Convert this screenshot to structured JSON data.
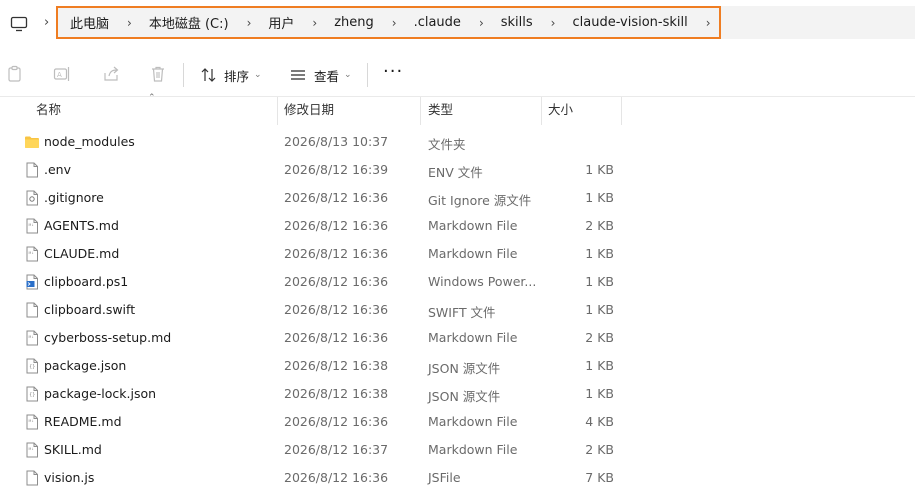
{
  "address_bar": {
    "root_icon": "this-pc-icon",
    "crumbs": [
      "此电脑",
      "本地磁盘 (C:)",
      "用户",
      "zheng",
      ".claude",
      "skills",
      "claude-vision-skill"
    ],
    "highlight_color": "#ef7d22"
  },
  "toolbar": {
    "icons": [
      "paste-icon",
      "rename-icon",
      "share-icon",
      "delete-icon"
    ],
    "sort_label": "排序",
    "view_label": "查看",
    "more_label": "···"
  },
  "columns": {
    "name": "名称",
    "date": "修改日期",
    "type": "类型",
    "size": "大小"
  },
  "files": [
    {
      "name": "node_modules",
      "date": "2026/8/13 10:37",
      "type": "文件夹",
      "size": "",
      "icon": "folder-icon"
    },
    {
      "name": ".env",
      "date": "2026/8/12 16:39",
      "type": "ENV 文件",
      "size": "1 KB",
      "icon": "file-icon"
    },
    {
      "name": ".gitignore",
      "date": "2026/8/12 16:36",
      "type": "Git Ignore 源文件",
      "size": "1 KB",
      "icon": "settings-file-icon"
    },
    {
      "name": "AGENTS.md",
      "date": "2026/8/12 16:36",
      "type": "Markdown File",
      "size": "2 KB",
      "icon": "markdown-file-icon"
    },
    {
      "name": "CLAUDE.md",
      "date": "2026/8/12 16:36",
      "type": "Markdown File",
      "size": "1 KB",
      "icon": "markdown-file-icon"
    },
    {
      "name": "clipboard.ps1",
      "date": "2026/8/12 16:36",
      "type": "Windows Power...",
      "size": "1 KB",
      "icon": "powershell-file-icon"
    },
    {
      "name": "clipboard.swift",
      "date": "2026/8/12 16:36",
      "type": "SWIFT 文件",
      "size": "1 KB",
      "icon": "file-icon"
    },
    {
      "name": "cyberboss-setup.md",
      "date": "2026/8/12 16:36",
      "type": "Markdown File",
      "size": "2 KB",
      "icon": "markdown-file-icon"
    },
    {
      "name": "package.json",
      "date": "2026/8/12 16:38",
      "type": "JSON 源文件",
      "size": "1 KB",
      "icon": "json-file-icon"
    },
    {
      "name": "package-lock.json",
      "date": "2026/8/12 16:38",
      "type": "JSON 源文件",
      "size": "1 KB",
      "icon": "json-file-icon"
    },
    {
      "name": "README.md",
      "date": "2026/8/12 16:36",
      "type": "Markdown File",
      "size": "4 KB",
      "icon": "markdown-file-icon"
    },
    {
      "name": "SKILL.md",
      "date": "2026/8/12 16:37",
      "type": "Markdown File",
      "size": "2 KB",
      "icon": "markdown-file-icon"
    },
    {
      "name": "vision.js",
      "date": "2026/8/12 16:36",
      "type": "JSFile",
      "size": "7 KB",
      "icon": "file-icon"
    }
  ]
}
